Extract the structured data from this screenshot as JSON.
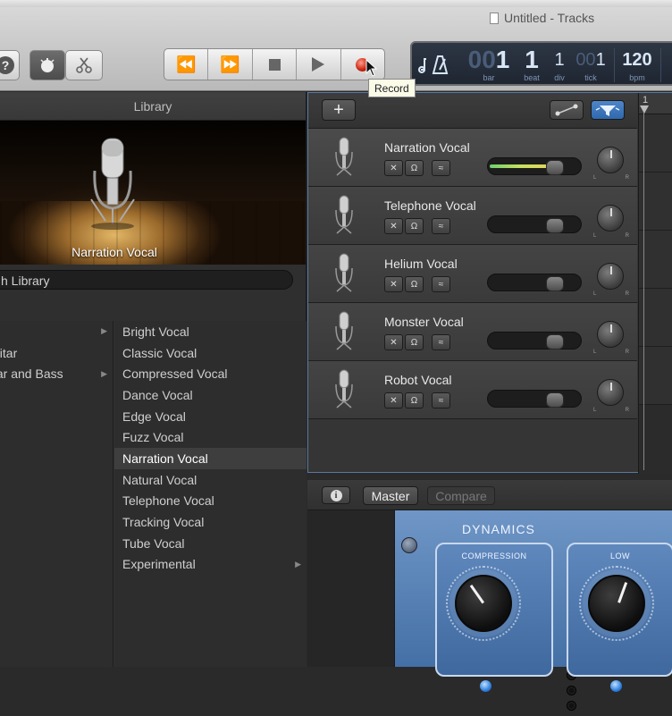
{
  "window": {
    "title": "Untitled - Tracks"
  },
  "tooltip": {
    "text": "Record"
  },
  "lcd": {
    "bar_value": "1",
    "bar_label": "bar",
    "beat_value": "1",
    "beat_label": "beat",
    "div_value": "1",
    "div_label": "div",
    "tick_value": "1",
    "tick_label": "tick",
    "tempo_value": "120",
    "tempo_label": "bpm"
  },
  "library": {
    "header": "Library",
    "preview_label": "Narration Vocal",
    "search_value": "h Library",
    "left_column": [
      {
        "label": "",
        "has_arrow": true
      },
      {
        "label": "uitar",
        "has_arrow": false
      },
      {
        "label": "tar and Bass",
        "has_arrow": true
      }
    ],
    "right_column": [
      {
        "label": "Bright Vocal",
        "selected": false,
        "has_arrow": false
      },
      {
        "label": "Classic Vocal",
        "selected": false,
        "has_arrow": false
      },
      {
        "label": "Compressed Vocal",
        "selected": false,
        "has_arrow": false
      },
      {
        "label": "Dance Vocal",
        "selected": false,
        "has_arrow": false
      },
      {
        "label": "Edge Vocal",
        "selected": false,
        "has_arrow": false
      },
      {
        "label": "Fuzz Vocal",
        "selected": false,
        "has_arrow": false
      },
      {
        "label": "Narration Vocal",
        "selected": true,
        "has_arrow": false
      },
      {
        "label": "Natural Vocal",
        "selected": false,
        "has_arrow": false
      },
      {
        "label": "Telephone Vocal",
        "selected": false,
        "has_arrow": false
      },
      {
        "label": "Tracking Vocal",
        "selected": false,
        "has_arrow": false
      },
      {
        "label": "Tube Vocal",
        "selected": false,
        "has_arrow": false
      },
      {
        "label": "Experimental",
        "selected": false,
        "has_arrow": true
      }
    ]
  },
  "tracks": {
    "add_label": "+",
    "ruler_label": "1",
    "items": [
      {
        "name": "Narration Vocal",
        "selected": true,
        "volume": 0.72,
        "meter": 0.68
      },
      {
        "name": "Telephone Vocal",
        "selected": false,
        "volume": 0.72,
        "meter": 0
      },
      {
        "name": "Helium Vocal",
        "selected": false,
        "volume": 0.72,
        "meter": 0
      },
      {
        "name": "Monster Vocal",
        "selected": false,
        "volume": 0.72,
        "meter": 0
      },
      {
        "name": "Robot Vocal",
        "selected": false,
        "volume": 0.72,
        "meter": 0
      }
    ]
  },
  "smart_controls": {
    "master_label": "Master",
    "compare_label": "Compare",
    "plugin_title": "DYNAMICS",
    "compression_label": "COMPRESSION",
    "low_label": "LOW"
  },
  "colors": {
    "accent_blue": "#3f74b8",
    "record_red": "#c8210f",
    "meter_green": "#6ed06e"
  }
}
